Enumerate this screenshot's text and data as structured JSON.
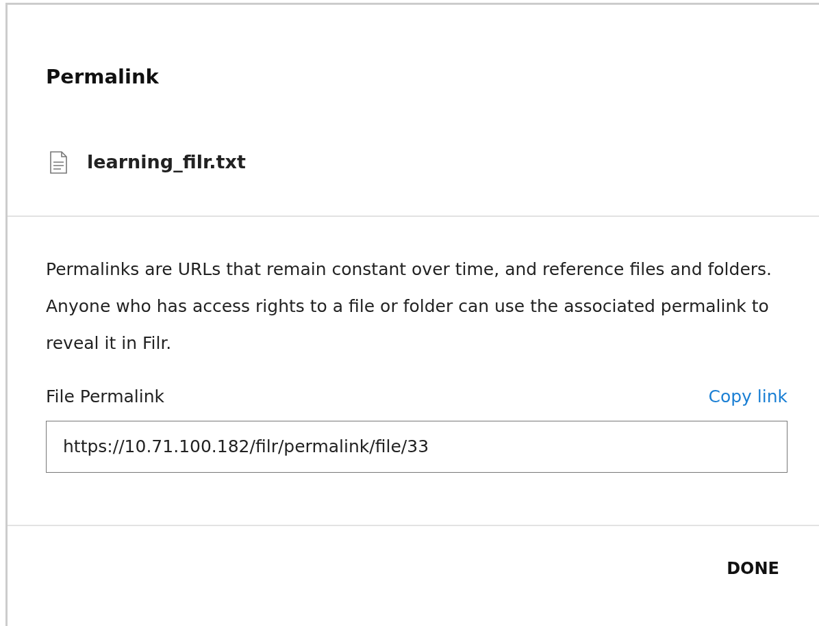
{
  "dialog": {
    "title": "Permalink",
    "file_name": "learning_filr.txt",
    "description": [
      "Permalinks are URLs that remain constant over time, and reference files and folders.",
      "Anyone who has access rights to a file or folder can use the associated permalink to reveal it in Filr."
    ],
    "field_label": "File Permalink",
    "copy_link": "Copy link",
    "permalink": "https://10.71.100.182/filr/permalink/file/33",
    "buttons": [
      "DONE"
    ]
  }
}
